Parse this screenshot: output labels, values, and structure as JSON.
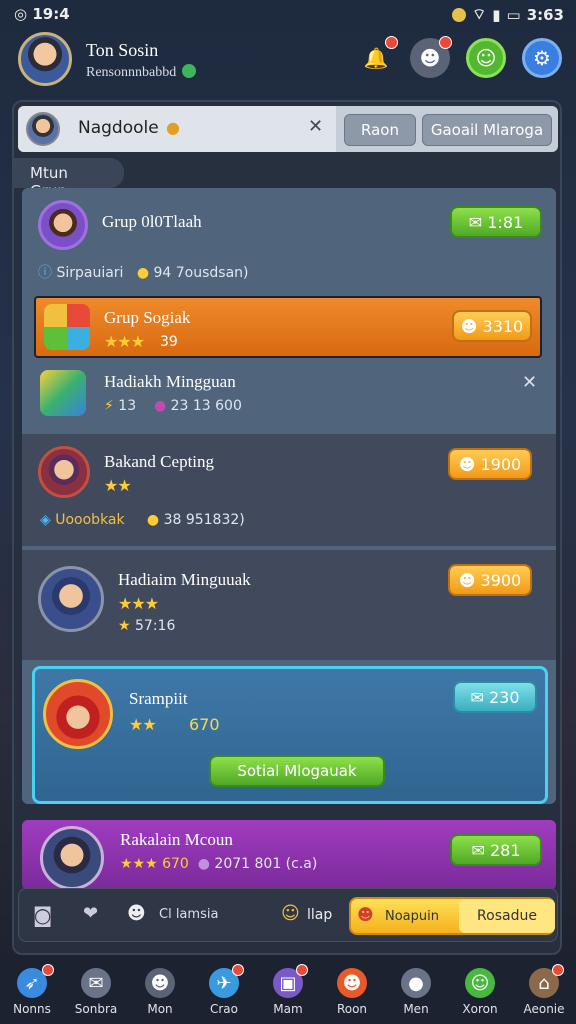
{
  "status": {
    "time_left": "19:4",
    "time_right": "3:63"
  },
  "profile": {
    "name": "Ton Sosin",
    "subtitle": "Rensonnnbabbd"
  },
  "search": {
    "name": "Nagdoole",
    "btn1": "Raon",
    "btn2": "Gaoail Mlaroga"
  },
  "tab": {
    "label": "Mtun Grup"
  },
  "rows": [
    {
      "title": "Grup 0l0Tlaah",
      "sub1": "Sirpauiari",
      "sub2": "94 7ousdsan)",
      "btn": "1:81"
    },
    {
      "title": "Grup Sogiak",
      "stars": "★★★",
      "meta": "39",
      "btn": "3310"
    },
    {
      "title": "Hadiakh Mingguan",
      "meta1": "13",
      "meta2": "23 13 600"
    },
    {
      "title": "Bakand Cepting",
      "stars": "★★",
      "sub1": "Uooobkak",
      "sub2": "38 951832)",
      "btn": "1900"
    },
    {
      "title": "Hadiaim Minguuak",
      "stars": "★★★",
      "meta": "57:16",
      "btn": "3900"
    },
    {
      "title": "Srampiit",
      "stars": "★★",
      "meta": "670",
      "btn": "230",
      "action": "Sotial Mlogauak"
    },
    {
      "title": "Rakalain Mcoun",
      "meta": "670",
      "sub2": "2071 801 (c.a)",
      "btn": "281"
    }
  ],
  "bottom": {
    "filter": "Cl lamsia",
    "tab2": "llap",
    "tab3": "Noapuin",
    "action": "Rosadue"
  },
  "nav": [
    "Nonns",
    "Sonbra",
    "Mon",
    "Crao",
    "Mam",
    "Roon",
    "Men",
    "Xoron",
    "Aeonie"
  ],
  "colors": {
    "accent_green": "#5ab82c",
    "accent_orange": "#f29a16",
    "accent_purple": "#8e2fa8"
  }
}
